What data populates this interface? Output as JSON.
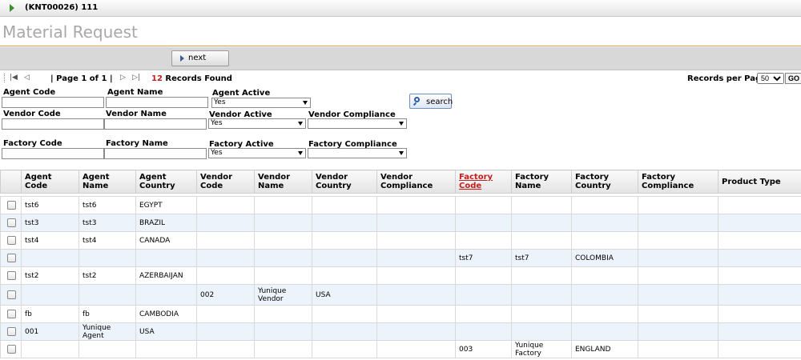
{
  "header": {
    "title": "(KNT00026) 111"
  },
  "page": {
    "title": "Material Request"
  },
  "toolbar": {
    "next_label": "next"
  },
  "pager": {
    "page_text": "| Page 1 of 1 |",
    "records_count": "12",
    "records_label": "Records Found",
    "per_page_label": "Records per Page:",
    "per_page_value": "50",
    "go_label": "GO"
  },
  "filters": {
    "agent_code": "Agent Code",
    "agent_name": "Agent Name",
    "agent_active": "Agent Active",
    "agent_active_value": "Yes",
    "vendor_code": "Vendor Code",
    "vendor_name": "Vendor Name",
    "vendor_active": "Vendor Active",
    "vendor_active_value": "Yes",
    "vendor_compliance": "Vendor Compliance",
    "vendor_compliance_value": "",
    "factory_code": "Factory Code",
    "factory_name": "Factory Name",
    "factory_active": "Factory Active",
    "factory_active_value": "Yes",
    "factory_compliance": "Factory Compliance",
    "factory_compliance_value": "",
    "search_label": "search"
  },
  "table": {
    "columns": [
      "",
      "Agent Code",
      "Agent Name",
      "Agent Country",
      "Vendor Code",
      "Vendor Name",
      "Vendor Country",
      "Vendor Compliance",
      "Factory Code",
      "Factory Name",
      "Factory Country",
      "Factory Compliance",
      "Product Type"
    ],
    "sorted_column": "Factory Code",
    "rows": [
      [
        "tst6",
        "tst6",
        "EGYPT",
        "",
        "",
        "",
        "",
        "",
        "",
        "",
        "",
        ""
      ],
      [
        "tst3",
        "tst3",
        "BRAZIL",
        "",
        "",
        "",
        "",
        "",
        "",
        "",
        "",
        ""
      ],
      [
        "tst4",
        "tst4",
        "CANADA",
        "",
        "",
        "",
        "",
        "",
        "",
        "",
        "",
        ""
      ],
      [
        "",
        "",
        "",
        "",
        "",
        "",
        "",
        "tst7",
        "tst7",
        "COLOMBIA",
        "",
        ""
      ],
      [
        "tst2",
        "tst2",
        "AZERBAIJAN",
        "",
        "",
        "",
        "",
        "",
        "",
        "",
        "",
        ""
      ],
      [
        "",
        "",
        "",
        "002",
        "Yunique Vendor",
        "USA",
        "",
        "",
        "",
        "",
        "",
        ""
      ],
      [
        "fb",
        "fb",
        "CAMBODIA",
        "",
        "",
        "",
        "",
        "",
        "",
        "",
        "",
        ""
      ],
      [
        "001",
        "Yunique Agent",
        "USA",
        "",
        "",
        "",
        "",
        "",
        "",
        "",
        "",
        ""
      ],
      [
        "",
        "",
        "",
        "",
        "",
        "",
        "",
        "003",
        "Yunique Factory",
        "ENGLAND",
        "",
        ""
      ]
    ]
  },
  "colors": {
    "accent": "#c41d1d",
    "title_gray": "#a8a8a8",
    "divider": "#d8a24c",
    "row_alt": "#edf3fa"
  }
}
